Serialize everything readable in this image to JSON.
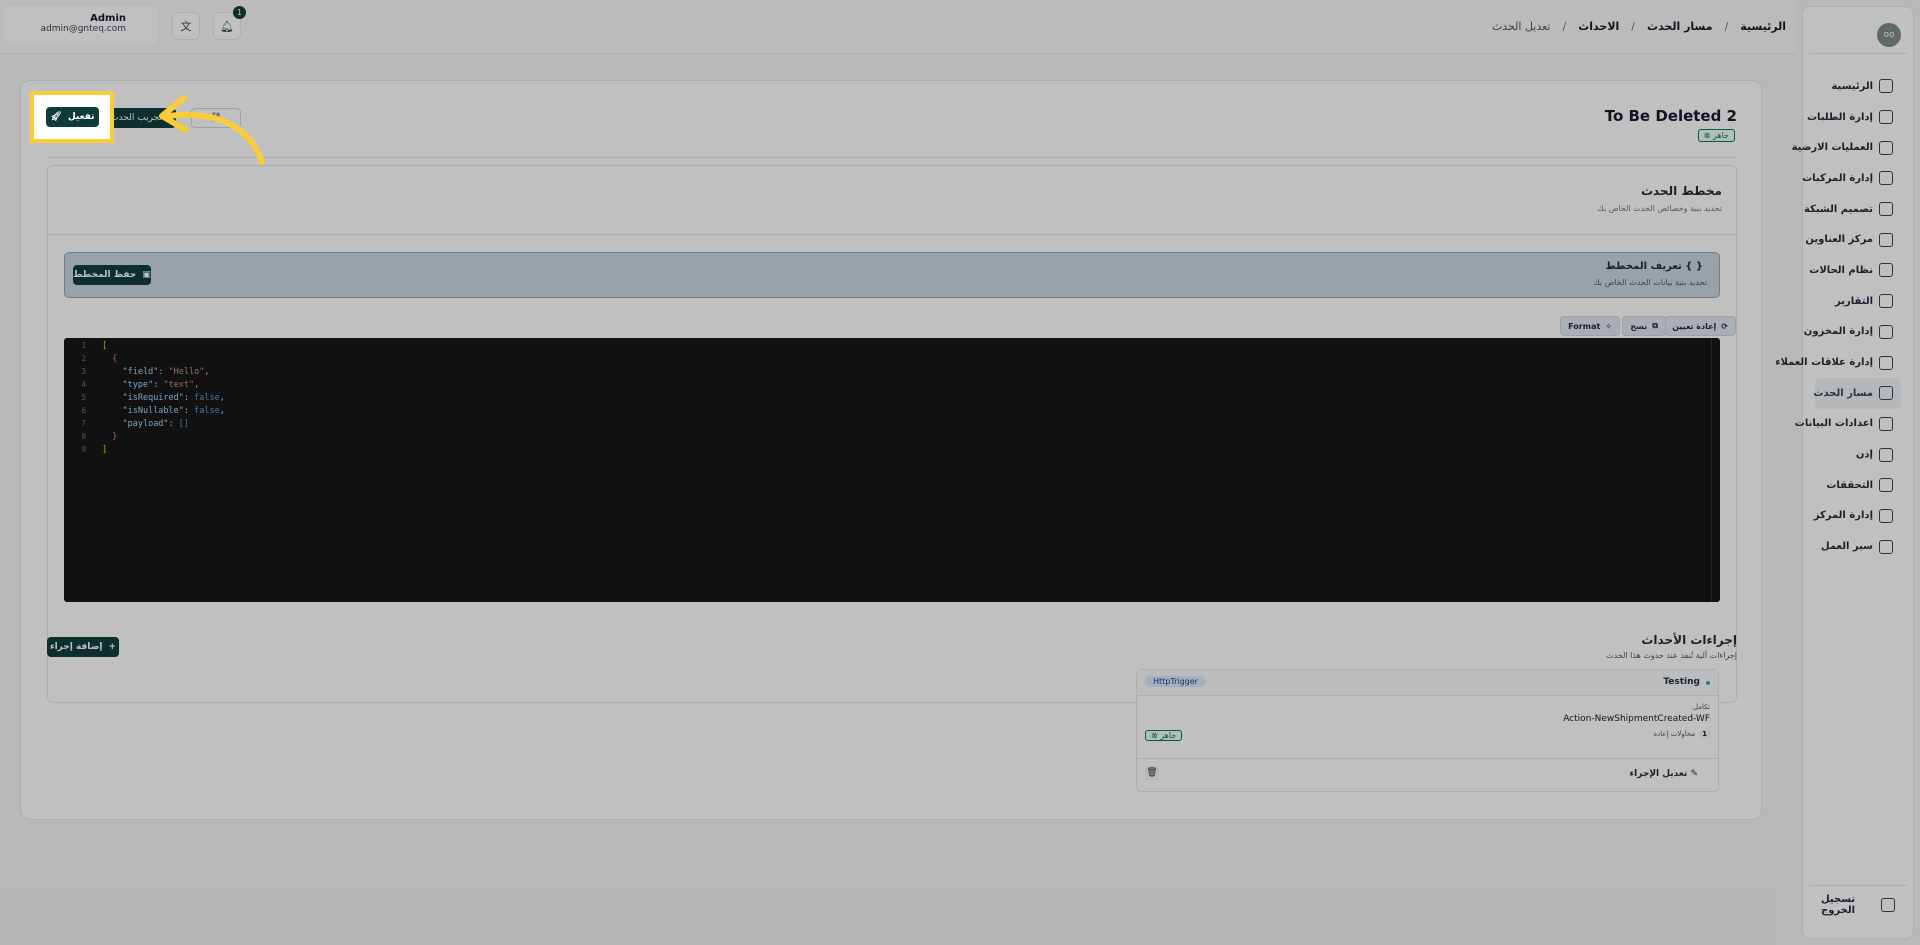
{
  "colors": {
    "primary": "#0f3b3a",
    "accent_highlight": "#f8cc3b",
    "success": "#047857"
  },
  "user": {
    "name": "Admin",
    "email": "admin@gnteq.com"
  },
  "notifications": {
    "count": "1",
    "icon": "bell-icon"
  },
  "topbar_icons": [
    "translate-icon",
    "bell-icon"
  ],
  "breadcrumb": [
    "الرئيسية",
    "مسار الحدث",
    "الاحداث",
    "تعديل الحدث"
  ],
  "sidebar": {
    "logo": "oo",
    "items": [
      {
        "label": "الرئيسية",
        "icon": "dashboard-icon"
      },
      {
        "label": "إدارة الطلبات",
        "icon": "orders-icon"
      },
      {
        "label": "العمليات الارضية",
        "icon": "ground-ops-icon"
      },
      {
        "label": "إدارة المركبات",
        "icon": "truck-icon"
      },
      {
        "label": "تصميم الشبكة",
        "icon": "network-icon"
      },
      {
        "label": "مركز العناوين",
        "icon": "address-icon"
      },
      {
        "label": "نظام الحالات",
        "icon": "status-icon"
      },
      {
        "label": "التقارير",
        "icon": "chart-icon"
      },
      {
        "label": "إدارة المخزون",
        "icon": "inventory-icon"
      },
      {
        "label": "إدارة علاقات العملاء",
        "icon": "crm-icon"
      },
      {
        "label": "مسار الحدث",
        "icon": "route-icon",
        "active": true
      },
      {
        "label": "اعدادات البيانات",
        "icon": "database-icon"
      },
      {
        "label": "إذن",
        "icon": "users-icon"
      },
      {
        "label": "التحققات",
        "icon": "tools-icon"
      },
      {
        "label": "إدارة المركز",
        "icon": "hub-icon"
      },
      {
        "label": "سير العمل",
        "icon": "workflow-icon"
      }
    ],
    "logout": "تسجيل الخروج"
  },
  "page": {
    "title": "To Be Deleted 2",
    "status": "جاهز",
    "activate_button": "تفعيل",
    "test_button": "تجريب الحدث",
    "edit_button_icon": "link-icon"
  },
  "schema": {
    "title": "مخطط الحدث",
    "subtitle": "تحديد بنية وخصائص الحدث الخاص بك",
    "definition_title": "تعريف المخطط",
    "definition_subtitle": "تحديد بنية بيانات الحدث الخاص بك",
    "save_button": "حفظ المخطط",
    "tools": {
      "reset": "إعادة تعيين",
      "copy": "نسخ",
      "format": "Format"
    },
    "code_lines": [
      {
        "n": "1",
        "text": "["
      },
      {
        "n": "2",
        "text": "  {"
      },
      {
        "n": "3",
        "key": "\"field\"",
        "val": "\"Hello\"",
        "indent": "    "
      },
      {
        "n": "4",
        "key": "\"type\"",
        "val": "\"text\"",
        "indent": "    "
      },
      {
        "n": "5",
        "key": "\"isRequired\"",
        "val": "false",
        "indent": "    "
      },
      {
        "n": "6",
        "key": "\"isNullable\"",
        "val": "false",
        "indent": "    "
      },
      {
        "n": "7",
        "key": "\"payload\"",
        "val": "[]",
        "indent": "    "
      },
      {
        "n": "8",
        "text": "  }"
      },
      {
        "n": "9",
        "text": "]"
      }
    ]
  },
  "actions": {
    "title": "إجراءات الأحداث",
    "subtitle": "إجراءات آلية تُنفذ عند حدوث هذا الحدث",
    "add_button": "إضافة إجراء",
    "items": [
      {
        "name": "Testing",
        "trigger": "HttpTrigger",
        "label": "تكامل",
        "value": "Action-NewShipmentCreated-WF",
        "retry_label": "محاولات إعادة",
        "retry_count": "1",
        "status": "جاهز",
        "edit": "تعديل الإجراء"
      }
    ]
  }
}
